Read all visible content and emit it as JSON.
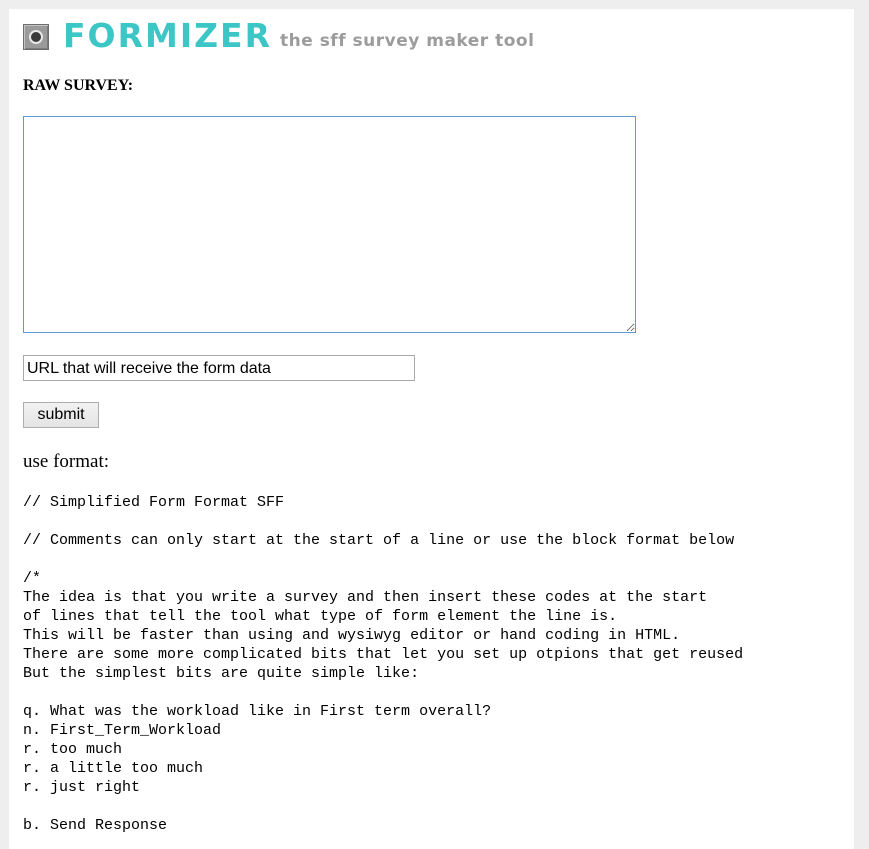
{
  "header": {
    "logo_icon": "radio-button-icon",
    "brand": "FORMIZER",
    "tagline": "the sff survey maker tool"
  },
  "form": {
    "raw_survey_label": "RAW SURVEY:",
    "survey_textarea_value": "",
    "url_input_value": "URL that will receive the form data",
    "submit_label": "submit"
  },
  "format": {
    "heading": "use format:",
    "lines": [
      "// Simplified Form Format SFF",
      "",
      "// Comments can only start at the start of a line or use the block format below",
      "",
      "/*",
      "The idea is that you write a survey and then insert these codes at the start",
      "of lines that tell the tool what type of form element the line is.",
      "This will be faster than using and wysiwyg editor or hand coding in HTML.",
      "There are some more complicated bits that let you set up otpions that get reused",
      "But the simplest bits are quite simple like:",
      "",
      "q. What was the workload like in First term overall?",
      "n. First_Term_Workload",
      "r. too much",
      "r. a little too much",
      "r. just right",
      "",
      "b. Send Response"
    ]
  },
  "colors": {
    "brand": "#3cc6c6",
    "tagline": "#9c9c9c",
    "textarea_border": "#5b9bd5",
    "page_background": "#eeeeee"
  }
}
